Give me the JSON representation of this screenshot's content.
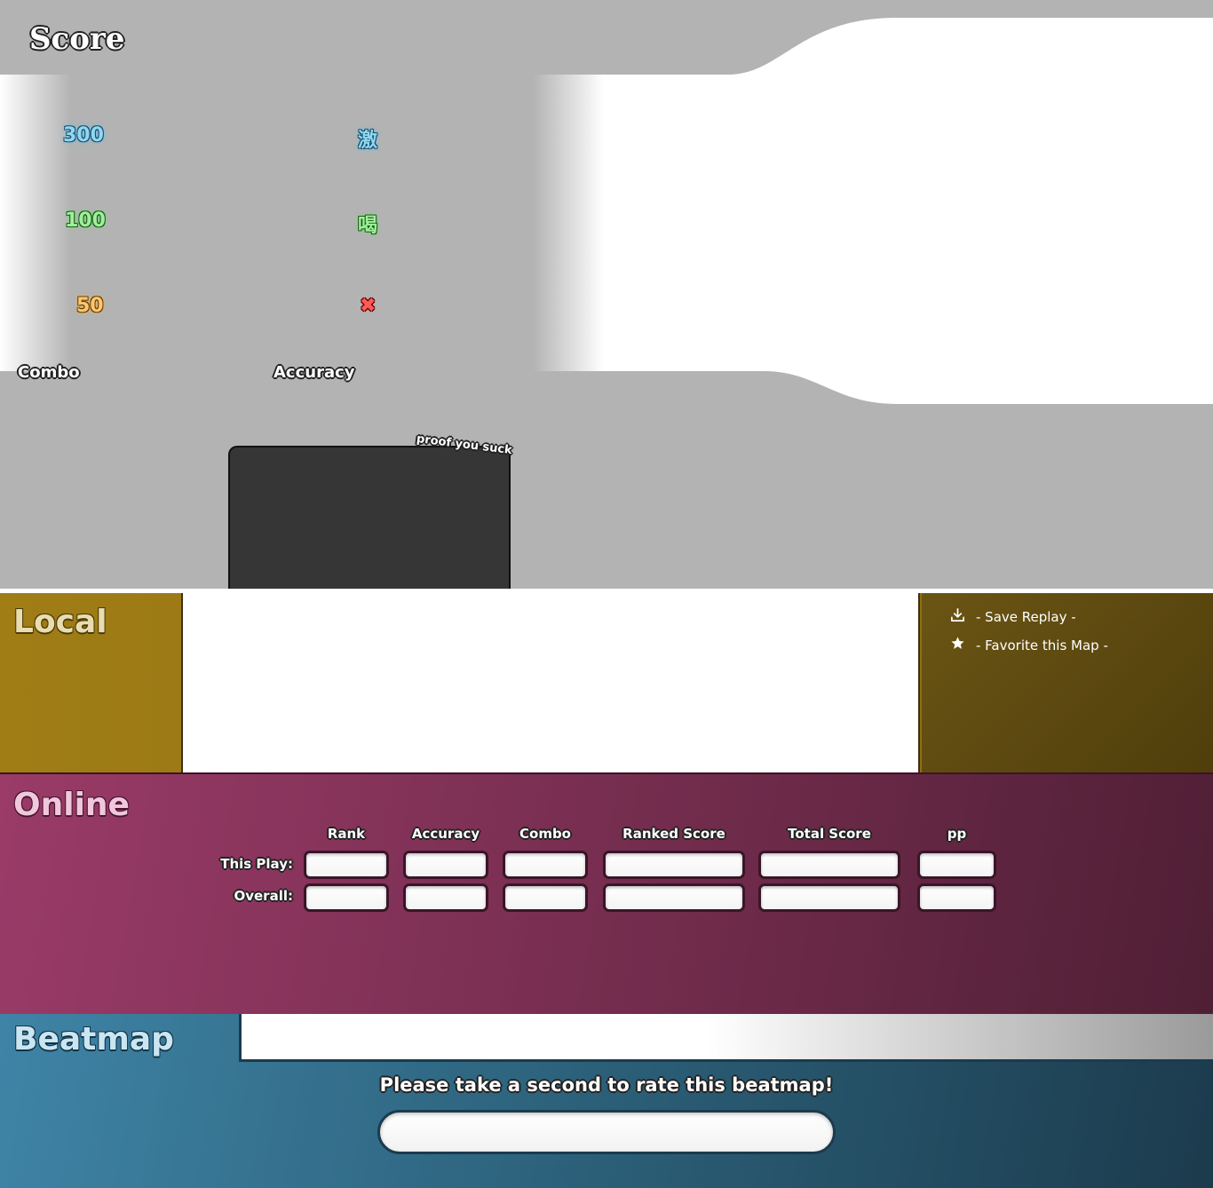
{
  "score": {
    "title": "Score",
    "hits": {
      "h300": "300",
      "h100": "100",
      "h50": "50",
      "geki": "激",
      "katu": "喝",
      "miss": "✖"
    },
    "combo_label": "Combo",
    "accuracy_label": "Accuracy",
    "replay_caption": "proof you suck"
  },
  "local": {
    "title": "Local",
    "actions": [
      {
        "label": "- Save Replay -",
        "icon": "download-icon"
      },
      {
        "label": "- Favorite this Map -",
        "icon": "star-icon"
      }
    ]
  },
  "online": {
    "title": "Online",
    "columns": [
      "Rank",
      "Accuracy",
      "Combo",
      "Ranked Score",
      "Total Score",
      "pp"
    ],
    "rows": [
      "This Play:",
      "Overall:"
    ]
  },
  "beatmap": {
    "title": "Beatmap",
    "rate_prompt": "Please take a second to rate this beatmap!"
  },
  "colors": {
    "local": "#a07d15",
    "online": "#9a3b68",
    "beatmap": "#3f84a6",
    "score_bg": "#b3b3b3"
  }
}
